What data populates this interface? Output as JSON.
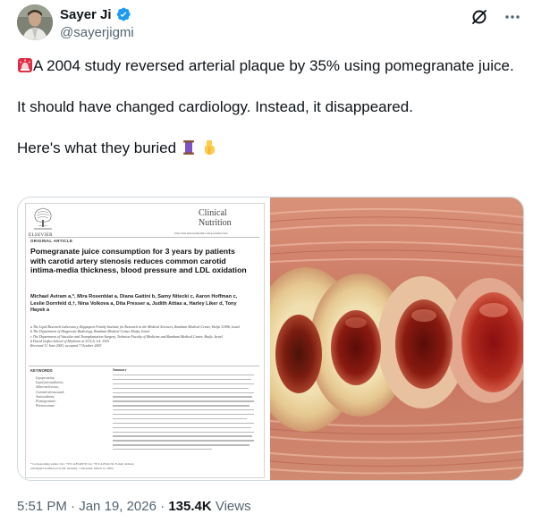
{
  "author": {
    "name": "Sayer Ji",
    "handle": "@sayerjigmi",
    "verified": true,
    "verified_color": "#1d9bf0"
  },
  "tweet": {
    "line1_icon": "rotating-light-emoji",
    "line1": "A 2004 study reversed arterial plaque by 35% using pomegranate juice.",
    "line2": "It should have changed cardiology. Instead, it disappeared.",
    "line3": "Here's what they buried",
    "line3_icons": [
      "thread-emoji",
      "pointing-down-emoji"
    ]
  },
  "paper": {
    "publisher": "ELSEVIER",
    "journal_line1": "Clinical",
    "journal_line2": "Nutrition",
    "journal_url": "http://intl.elsevierhealth.com/journals/clnu",
    "article_type": "ORIGINAL ARTICLE",
    "title": "Pomegranate juice consumption for 3 years by patients with carotid artery stenosis reduces common carotid intima-media thickness, blood pressure and LDL oxidation",
    "authors": "Michael Aviram a,*, Mira Rosenblat a, Diana Gaitini b, Samy Nitecki c, Aaron Hoffman c, Leslie Dornfeld d,†, Nina Volkova a, Dita Presser a, Judith Attias a, Harley Liker d, Tony Hayek a",
    "affiliations": [
      "a The Lipid Research Laboratory, Rappaport Family Institute for Research in the Medical Sciences, Rambam Medical Center, Haifa 31096, Israel",
      "b The Department of Diagnostic Radiology, Rambam Medical Center, Haifa, Israel",
      "c The Department of Vascular and Transplantation Surgery, Technion Faculty of Medicine and Rambam Medical Center, Haifa, Israel",
      "d David Geffen School of Medicine at UCLA, LA, USA"
    ],
    "received": "Received 11 June 2003; accepted 7 October 2003",
    "keywords_title": "KEYWORDS",
    "keywords": [
      "Lipoproteins;",
      "Lipid peroxidation;",
      "Atherosclerosis;",
      "Carotid ultrasound;",
      "Antioxidants;",
      "Pomegranate;",
      "Paraoxonase"
    ],
    "abstract_lead": "Summary",
    "footnote": "*Corresponding author. Tel.: +972-4-8542970; fax: +972-4-8542130. E-mail address: aviram@tx.technion.ac.il (M. Aviram). † Deceased, March 12, 2003."
  },
  "meta": {
    "time": "5:51 PM",
    "separator": "·",
    "date": "Jan 19, 2026",
    "views_count": "135.4K",
    "views_label": "Views"
  }
}
